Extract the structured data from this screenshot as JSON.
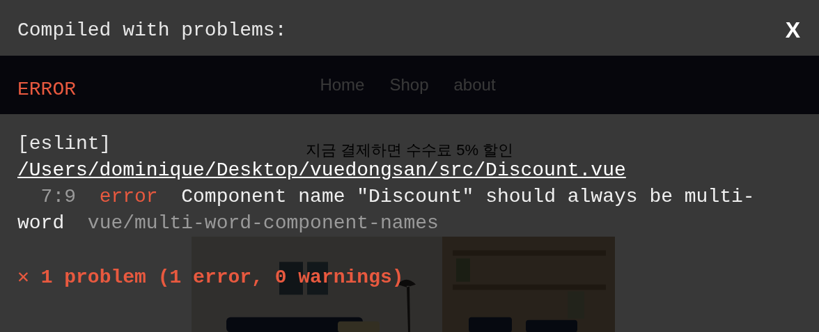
{
  "page": {
    "nav": [
      "Home",
      "Shop",
      "about"
    ],
    "banner": "지금 결제하면 수수료 5% 할인"
  },
  "overlay": {
    "title": "Compiled with problems:",
    "close": "X",
    "error_label": "ERROR",
    "message": {
      "tool": "[eslint]",
      "file": "/Users/dominique/Desktop/vuedongsan/src/Discount.vue",
      "location": "7:9",
      "severity": "error",
      "text": "Component name \"Discount\" should always be multi-word",
      "rule": "vue/multi-word-component-names"
    },
    "summary": "✕ 1 problem (1 error, 0 warnings)"
  }
}
